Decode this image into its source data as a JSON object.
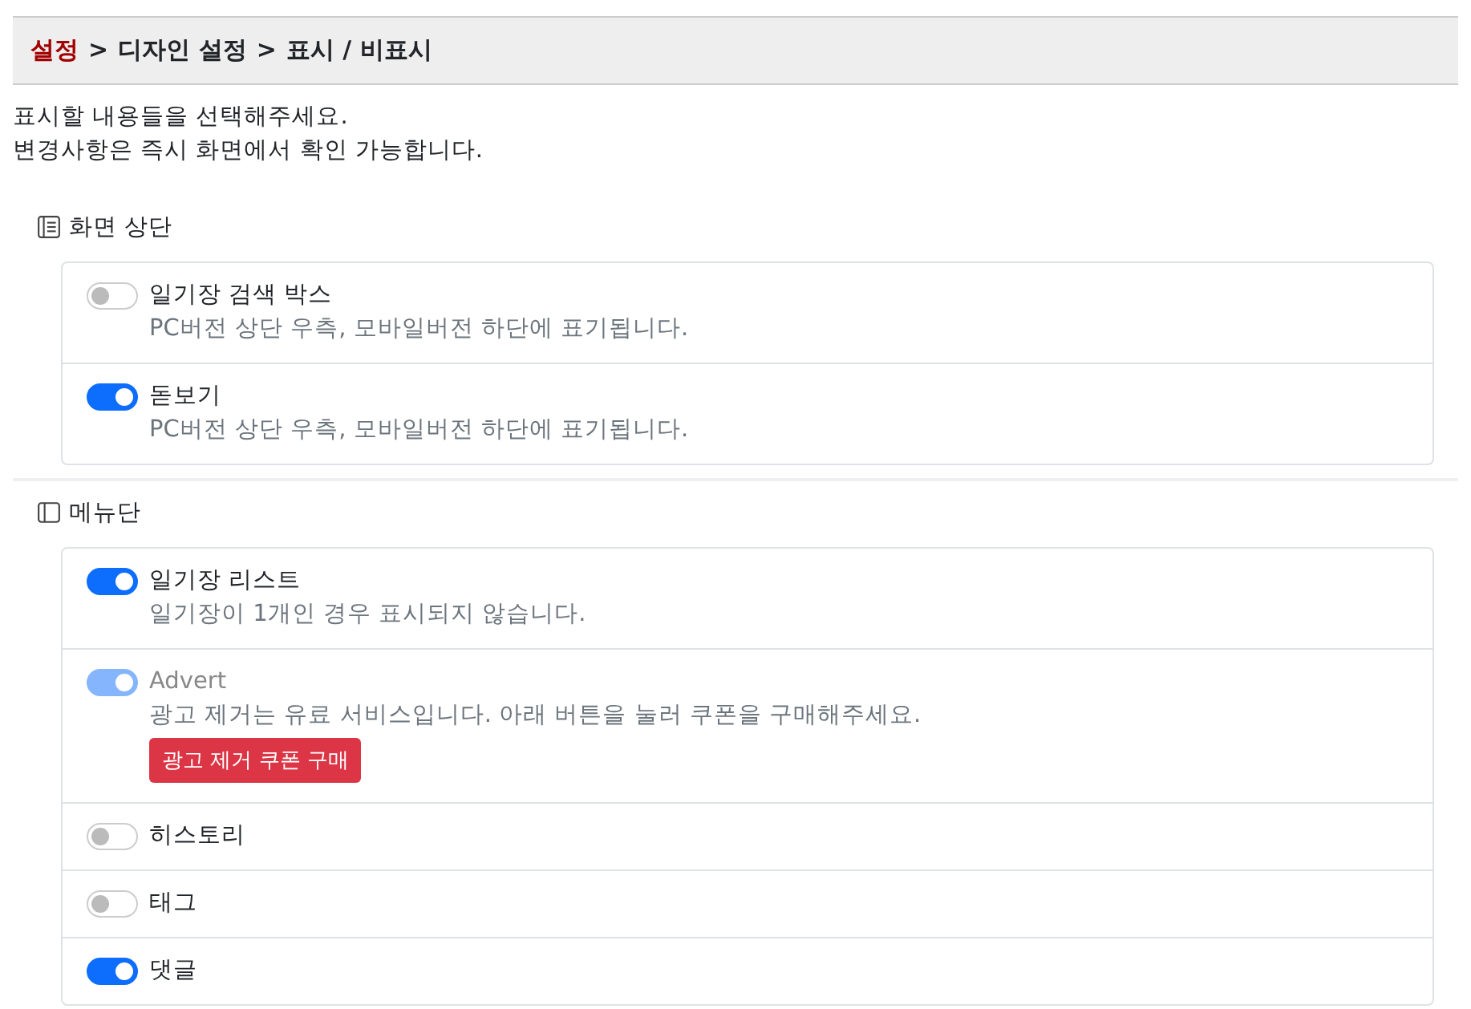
{
  "breadcrumb": [
    {
      "kind": "link",
      "text": "설정"
    },
    {
      "kind": "sep",
      "text": ">"
    },
    {
      "kind": "crumb",
      "text": "디자인 설정"
    },
    {
      "kind": "sep",
      "text": ">"
    },
    {
      "kind": "crumb",
      "text": "표시 / 비표시"
    }
  ],
  "intro": [
    "표시할 내용들을 선택해주세요.",
    "변경사항은 즉시 화면에서 확인 가능합니다."
  ],
  "sections": [
    {
      "title": "화면 상단",
      "kind": "list",
      "items": [
        {
          "label": "일기장 검색 박스",
          "description": "PC버전 상단 우측, 모바일버전 하단에 표기됩니다.",
          "checked": false,
          "disabled": false
        },
        {
          "label": "돋보기",
          "description": "PC버전 상단 우측, 모바일버전 하단에 표기됩니다.",
          "checked": true,
          "disabled": false
        }
      ]
    },
    {
      "title": "메뉴단",
      "kind": "sidebar",
      "items": [
        {
          "label": "일기장 리스트",
          "description": "일기장이 1개인 경우 표시되지 않습니다.",
          "checked": true,
          "disabled": false
        },
        {
          "label": "Advert",
          "description": "광고 제거는 유료 서비스입니다. 아래 버튼을 눌러 쿠폰을 구매해주세요.",
          "checked": true,
          "disabled": true,
          "button": "광고 제거 쿠폰 구매"
        },
        {
          "label": "히스토리",
          "checked": false,
          "disabled": false
        },
        {
          "label": "태그",
          "checked": false,
          "disabled": false
        },
        {
          "label": "댓글",
          "checked": true,
          "disabled": false
        }
      ]
    }
  ]
}
